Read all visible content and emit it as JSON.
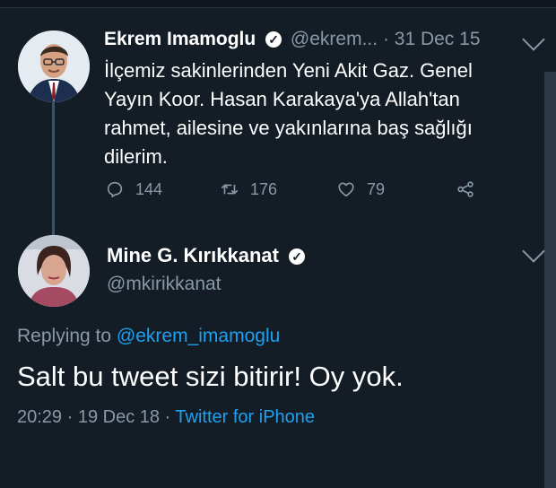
{
  "tweet1": {
    "name": "Ekrem Imamoglu",
    "handle": "@ekrem...",
    "time": "· 31 Dec 15",
    "text_lines": [
      "İlçemiz sakinlerinden Yeni Akit Gaz. Genel",
      "Yayın Koor. Hasan Karakaya'ya Allah'tan",
      "rahmet, ailesine ve yakınlarına baş sağlığı",
      "dilerim."
    ],
    "replies": "144",
    "retweets": "176",
    "likes": "79"
  },
  "tweet2": {
    "name": "Mine G. Kırıkkanat",
    "handle": "@mkirikkanat",
    "replying_prefix": "Replying to",
    "replying_to": "@ekrem_imamoglu",
    "text": "Salt bu tweet sizi bitirir! Oy yok.",
    "timestamp": "20:29 · 19 Dec 18 ·",
    "source": "Twitter for iPhone"
  },
  "icons": {
    "verified": "verified-badge-icon",
    "reply": "reply-bubble-icon",
    "retweet": "retweet-icon",
    "like": "heart-icon",
    "share": "share-icon",
    "menu": "chevron-down-icon"
  },
  "colors": {
    "background": "#141d26",
    "secondary_text": "#8899a6",
    "link": "#1da1f2"
  }
}
